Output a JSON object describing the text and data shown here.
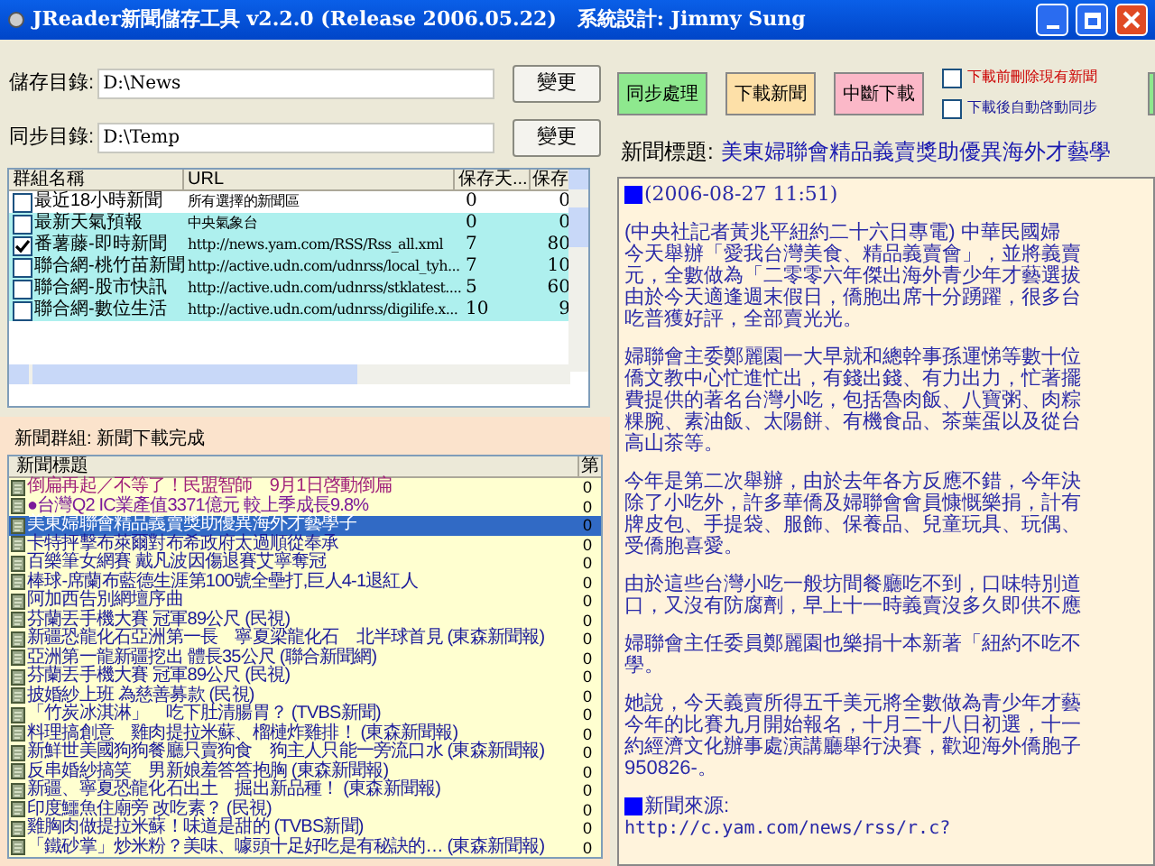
{
  "window": {
    "title": "JReader新聞儲存工具 v2.2.0 (Release 2006.05.22)   系統設計: Jimmy Sung"
  },
  "folders": [
    {
      "label": "儲存目錄:",
      "value": "D:\\News",
      "button": "變更"
    },
    {
      "label": "同步目錄:",
      "value": "D:\\Temp",
      "button": "變更"
    }
  ],
  "actions": [
    {
      "label": "同步處理",
      "color": "#8ee88e"
    },
    {
      "label": "下載新聞",
      "color": "#fde0a8"
    },
    {
      "label": "中斷下載",
      "color": "#fbb8c8"
    }
  ],
  "options": [
    {
      "label": "下載前刪除現有新聞",
      "checked": false,
      "color": "#cc0000"
    },
    {
      "label": "下載後自動啓動同步",
      "checked": false,
      "color": "#1a1a9a"
    }
  ],
  "groups_table": {
    "columns": [
      "群組名稱",
      "URL",
      "保存天...",
      "保存"
    ],
    "rows": [
      {
        "name": "最近18小時新聞",
        "url": "所有選擇的新聞區",
        "days": "0",
        "count": "0",
        "checked": false,
        "highlighted": false
      },
      {
        "name": "最新天氣預報",
        "url": "中央氣象台",
        "days": "0",
        "count": "0",
        "checked": false,
        "highlighted": true
      },
      {
        "name": "番薯藤-即時新聞",
        "url": "http://news.yam.com/RSS/Rss_all.xml",
        "days": "7",
        "count": "80",
        "checked": true,
        "highlighted": true
      },
      {
        "name": "聯合網-桃竹苗新聞",
        "url": "http://active.udn.com/udnrss/local_tyh...",
        "days": "7",
        "count": "10",
        "checked": false,
        "highlighted": true
      },
      {
        "name": "聯合網-股市快訊",
        "url": "http://active.udn.com/udnrss/stklatest....",
        "days": "5",
        "count": "60",
        "checked": false,
        "highlighted": true
      },
      {
        "name": "聯合網-數位生活",
        "url": "http://active.udn.com/udnrss/digilife.x...",
        "days": "10",
        "count": "9",
        "checked": false,
        "highlighted": true
      }
    ]
  },
  "status": "新聞群組: 新聞下載完成",
  "news_table": {
    "columns": [
      "新聞標題",
      "第"
    ],
    "rows": [
      {
        "title": "倒扁再起／不等了！民盟智師　9月1日啓動倒扁",
        "column_2": "0",
        "color": "#a0207a",
        "selected": false
      },
      {
        "title": "●台灣Q2 IC業產值3371億元 較上季成長9.8%",
        "column_2": "0",
        "color": "#7a1a9a",
        "selected": false
      },
      {
        "title": "美東婦聯會精品義賣獎助優異海外才藝學子",
        "column_2": "0",
        "selected": true
      },
      {
        "title": "卡特抨擊布萊爾對布希政府太過順從奉承",
        "column_2": "0",
        "color": "#1a1a9a",
        "selected": false
      },
      {
        "title": "百樂筆女網賽 戴凡波因傷退賽艾寧奪冠",
        "column_2": "0",
        "color": "#1a1a9a",
        "selected": false
      },
      {
        "title": "棒球-席蘭布藍德生涯第100號全壘打,巨人4-1退紅人",
        "column_2": "0",
        "color": "#1a1a9a",
        "selected": false
      },
      {
        "title": "阿加西告別網壇序曲",
        "column_2": "0",
        "color": "#1a1a9a",
        "selected": false
      },
      {
        "title": "芬蘭丟手機大賽 冠軍89公尺 (民視)",
        "column_2": "0",
        "color": "#1a1a9a",
        "selected": false
      },
      {
        "title": "新疆恐龍化石亞洲第一長　寧夏梁龍化石　北半球首見 (東森新聞報)",
        "column_2": "0",
        "color": "#1a1a9a",
        "selected": false
      },
      {
        "title": "亞洲第一龍新疆挖出 體長35公尺 (聯合新聞網)",
        "column_2": "0",
        "color": "#1a1a9a",
        "selected": false
      },
      {
        "title": "芬蘭丟手機大賽 冠軍89公尺 (民視)",
        "column_2": "0",
        "color": "#1a1a9a",
        "selected": false
      },
      {
        "title": "披婚紗上班 為慈善募款 (民視)",
        "column_2": "0",
        "color": "#1a1a9a",
        "selected": false
      },
      {
        "title": "「竹炭冰淇淋」　吃下肚清腸胃？ (TVBS新聞)",
        "column_2": "0",
        "color": "#1a1a9a",
        "selected": false
      },
      {
        "title": "料理搞創意　雞肉提拉米蘇、榴槤炸雞排！ (東森新聞報)",
        "column_2": "0",
        "color": "#1a1a9a",
        "selected": false
      },
      {
        "title": "新鮮世美國狗狗餐廳只賣狗食　狗主人只能一旁流口水 (東森新聞報)",
        "column_2": "0",
        "color": "#1a1a9a",
        "selected": false
      },
      {
        "title": "反串婚紗搞笑　男新娘羞答答抱胸 (東森新聞報)",
        "column_2": "0",
        "color": "#1a1a9a",
        "selected": false
      },
      {
        "title": "新疆、寧夏恐龍化石出土　掘出新品種！ (東森新聞報)",
        "column_2": "0",
        "color": "#1a1a9a",
        "selected": false
      },
      {
        "title": "印度鱷魚住廟旁 改吃素？ (民視)",
        "column_2": "0",
        "color": "#1a1a9a",
        "selected": false
      },
      {
        "title": "雞胸肉做提拉米蘇！味道是甜的 (TVBS新聞)",
        "column_2": "0",
        "color": "#1a1a9a",
        "selected": false
      },
      {
        "title": "「鐵砂掌」炒米粉？美味、噱頭十足好吃是有秘訣的… (東森新聞報)",
        "column_2": "0",
        "color": "#1a1a9a",
        "selected": false
      }
    ]
  },
  "article": {
    "label": "新聞標題:",
    "headline": "美東婦聯會精品義賣獎助優異海外才藝學",
    "date": "(2006-08-27 11:51)",
    "paragraphs": [
      [
        "(中央社記者黃兆平紐約二十六日專電) 中華民國婦",
        "今天舉辦「愛我台灣美食、精品義賣會」，並將義賣",
        "元，全數做為「二零零六年傑出海外青少年才藝選拔",
        "由於今天適逢週末假日，僑胞出席十分踴躍，很多台",
        "吃普獲好評，全部賣光光。"
      ],
      [
        "婦聯會主委鄭麗園一大早就和總幹事孫運悌等數十位",
        "僑文教中心忙進忙出，有錢出錢、有力出力，忙著擺",
        "費提供的著名台灣小吃，包括魯肉飯、八寶粥、肉粽",
        "粿腕、素油飯、太陽餅、有機食品、茶葉蛋以及從台",
        "高山茶等。"
      ],
      [
        "今年是第二次舉辦，由於去年各方反應不錯，今年決",
        "除了小吃外，許多華僑及婦聯會會員慷慨樂捐，計有",
        "牌皮包、手提袋、服飾、保養品、兒童玩具、玩偶、",
        "受僑胞喜愛。"
      ],
      [
        "由於這些台灣小吃一般坊間餐廳吃不到，口味特別道",
        "口，又沒有防腐劑，早上十一時義賣沒多久即供不應"
      ],
      [
        "婦聯會主任委員鄭麗園也樂捐十本新著「紐約不吃不",
        "學。"
      ],
      [
        "她說，今天義賣所得五千美元將全數做為青少年才藝",
        "今年的比賽九月開始報名，十月二十八日初選，十一",
        "約經濟文化辦事處演講廳舉行決賽，歡迎海外僑胞子",
        "950826-。"
      ]
    ],
    "source_label": "新聞來源:",
    "source_url": "http://c.yam.com/news/rss/r.c?"
  }
}
